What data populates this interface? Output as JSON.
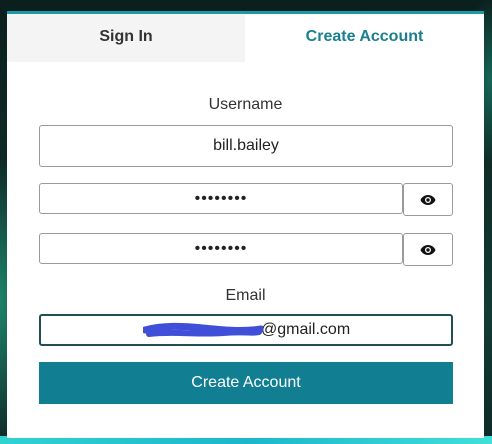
{
  "tabs": {
    "signin_label": "Sign In",
    "create_label": "Create Account",
    "active": "Create Account"
  },
  "form": {
    "username_label": "Username",
    "username_value": "bill.bailey",
    "password_value": "••••••••",
    "confirm_password_value": "••••••••",
    "email_label": "Email",
    "email_value": "@gmail.com",
    "submit_label": "Create Account"
  },
  "icons": {
    "toggle_password": "eye-icon",
    "toggle_confirm_password": "eye-icon",
    "email_redaction": "scribble-redaction"
  },
  "colors": {
    "accent": "#117e92",
    "active_tab_text": "#1a7f8e",
    "inactive_tab_bg": "#f4f4f4",
    "redaction": "#3f4fd8"
  }
}
